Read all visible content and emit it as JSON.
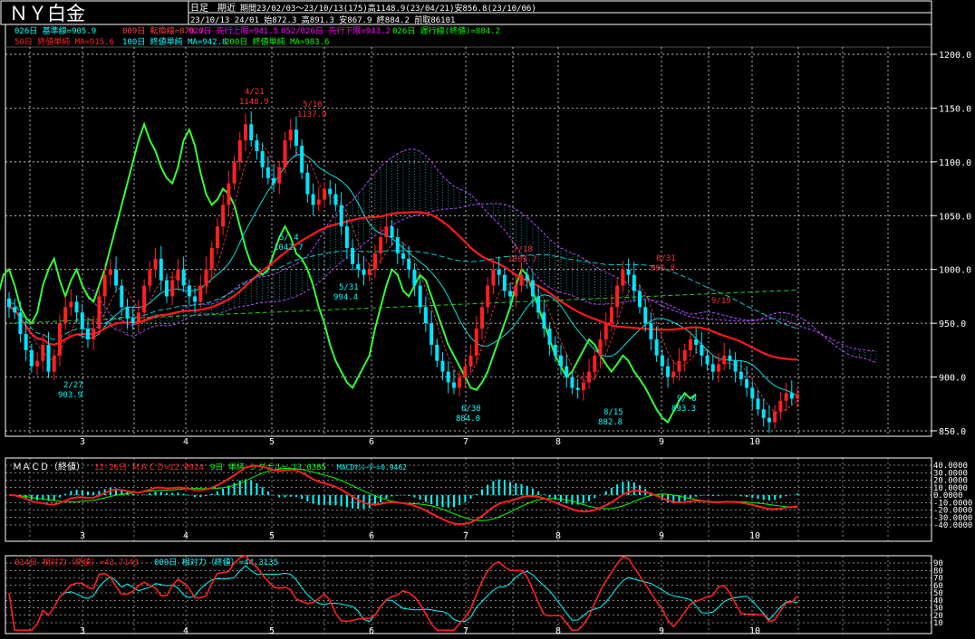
{
  "header": {
    "title": "ＮＹ白金",
    "mode": "日足　期近",
    "period": "期間23/02/03～23/10/13(175)高1148.9(23/04/21)安856.8(23/10/06)",
    "ohlc": "23/10/13 24/01 始872.3 高891.3 安867.9 終884.2 前取86101"
  },
  "legend": [
    {
      "text": "026日 基準線=905.9",
      "color": "#00ffff"
    },
    {
      "text": "009日 転換線=879.7",
      "color": "#ff4040"
    },
    {
      "text": "026日 先行上限=941.5",
      "color": "#ff00ff"
    },
    {
      "text": "052/026日 先行下限=943.2",
      "color": "#ff00ff"
    },
    {
      "text": "026日 遅行線(終値)=884.2",
      "color": "#00ff00"
    },
    {
      "text": "50日 終値単純 MA=915.6",
      "color": "#ff2020"
    },
    {
      "text": "100日 終値単純 MA=942.8",
      "color": "#00ffff"
    },
    {
      "text": "200日 終値単純 MA=983.6",
      "color": "#00ff00"
    }
  ],
  "macd_label": {
    "title": "ＭＡＣＤ（終値）",
    "main": "12-26日 ＭＡＣＤ=12.0924",
    "signal": "9日 単純 シグナル=-13.0385",
    "osc": "MACDｵｼﾚｰﾀｰ=0.9462"
  },
  "rsi_label": {
    "a": "014日 相対力（終値）=43.7143",
    "b": "009日 相対力（終値）=44.3135"
  },
  "months": [
    "3",
    "4",
    "5",
    "6",
    "7",
    "8",
    "9",
    "10"
  ],
  "annotations": [
    {
      "date": "2/27",
      "value": "903.9",
      "color": "#00ffff"
    },
    {
      "date": "4/21",
      "value": "1148.9",
      "color": "#ff3030"
    },
    {
      "date": "5/10",
      "value": "1137.9",
      "color": "#ff3030"
    },
    {
      "date": "5/ 4",
      "value": "1042.7",
      "color": "#00ffff"
    },
    {
      "date": "5/31",
      "value": "994.4",
      "color": "#00ffff"
    },
    {
      "date": "6/30",
      "value": "884.0",
      "color": "#00ffff"
    },
    {
      "date": "7/18",
      "value": "1003.7",
      "color": "#ff3030"
    },
    {
      "date": "8/15",
      "value": "882.8",
      "color": "#00ffff"
    },
    {
      "date": "8/31",
      "value": "996.8",
      "color": "#ff3030"
    },
    {
      "date": "9/ 8",
      "value": "893.3",
      "color": "#00ffff"
    },
    {
      "date": "9/19",
      "value": "",
      "color": "#ff3030"
    }
  ],
  "chart_data": [
    {
      "type": "candlestick",
      "title": "ＮＹ白金",
      "ylim": [
        850,
        1200
      ],
      "yticks": [
        "1200.0",
        "1150.0",
        "1100.0",
        "1050.0",
        "1000.0",
        "950.0",
        "900.0",
        "850.0"
      ],
      "xticks": [
        "3",
        "4",
        "5",
        "6",
        "7",
        "8",
        "9",
        "10"
      ],
      "close": [
        965,
        960,
        940,
        925,
        910,
        915,
        930,
        905,
        920,
        950,
        965,
        970,
        960,
        945,
        935,
        945,
        975,
        995,
        1000,
        985,
        965,
        955,
        950,
        960,
        985,
        1000,
        1010,
        990,
        975,
        990,
        1000,
        985,
        975,
        970,
        985,
        1000,
        1020,
        1040,
        1060,
        1080,
        1100,
        1120,
        1135,
        1120,
        1110,
        1095,
        1085,
        1080,
        1095,
        1120,
        1130,
        1115,
        1090,
        1070,
        1060,
        1065,
        1075,
        1070,
        1060,
        1040,
        1020,
        1005,
        1000,
        995,
        1000,
        1015,
        1030,
        1040,
        1030,
        1015,
        1010,
        1000,
        985,
        965,
        950,
        930,
        915,
        905,
        895,
        890,
        900,
        910,
        920,
        945,
        965,
        985,
        1000,
        995,
        980,
        975,
        985,
        995,
        990,
        975,
        960,
        945,
        930,
        920,
        910,
        900,
        890,
        888,
        895,
        905,
        920,
        935,
        950,
        965,
        985,
        1000,
        995,
        980,
        965,
        950,
        935,
        920,
        910,
        900,
        905,
        915,
        925,
        935,
        930,
        920,
        912,
        905,
        912,
        920,
        915,
        905,
        898,
        890,
        880,
        870,
        862,
        858,
        868,
        878,
        885,
        880,
        884
      ],
      "series": [
        {
          "name": "026日 基準線",
          "last": 905.9
        },
        {
          "name": "009日 転換線",
          "last": 879.7
        },
        {
          "name": "026日 先行上限",
          "last": 941.5
        },
        {
          "name": "052/026日 先行下限",
          "last": 943.2
        },
        {
          "name": "026日 遅行線(終値)",
          "last": 884.2
        },
        {
          "name": "50日 終値単純 MA",
          "last": 915.6
        },
        {
          "name": "100日 終値単純 MA",
          "last": 942.8
        },
        {
          "name": "200日 終値単純 MA",
          "last": 983.6
        }
      ],
      "high": {
        "date": "23/04/21",
        "value": 1148.9
      },
      "low": {
        "date": "23/10/06",
        "value": 856.8
      }
    },
    {
      "type": "bar",
      "title": "ＭＡＣＤ（終値）",
      "yticks": [
        "40.0000",
        "30.0000",
        "20.0000",
        "10.0000",
        "0.0000",
        "-10.0000",
        "-20.0000",
        "-30.0000",
        "-40.0000"
      ],
      "ylim": [
        -40,
        40
      ],
      "series": [
        {
          "name": "12-26日 ＭＡＣＤ",
          "last": 12.0924
        },
        {
          "name": "9日 単純 シグナル",
          "last": -13.0385
        },
        {
          "name": "MACDｵｼﾚｰﾀｰ",
          "last": 0.9462
        }
      ]
    },
    {
      "type": "line",
      "title": "相対力",
      "yticks": [
        "90",
        "80",
        "70",
        "60",
        "50",
        "40",
        "30",
        "20",
        "10"
      ],
      "ylim": [
        10,
        90
      ],
      "series": [
        {
          "name": "014日 相対力（終値）",
          "last": 43.7143
        },
        {
          "name": "009日 相対力（終値）",
          "last": 44.3135
        }
      ]
    }
  ],
  "colors": {
    "up": "#ff2020",
    "down": "#00e5ff",
    "grid": "#ffffff",
    "kumo": "#00ffff",
    "macd": "#ff2020",
    "signal": "#00ff00",
    "osc": "#00ffff",
    "rsi": "#ff2020"
  }
}
